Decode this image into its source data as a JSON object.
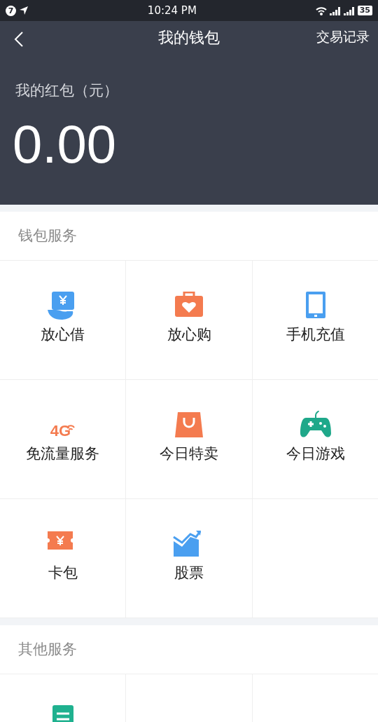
{
  "status_bar": {
    "notification_count": "7",
    "time": "10:24 PM",
    "battery": "35"
  },
  "header": {
    "title": "我的钱包",
    "action": "交易记录"
  },
  "balance": {
    "label": "我的红包（元）",
    "amount": "0.00"
  },
  "sections": [
    {
      "title": "钱包服务",
      "items": [
        {
          "label": "放心借",
          "kind": "loan"
        },
        {
          "label": "放心购",
          "kind": "gift"
        },
        {
          "label": "手机充值",
          "kind": "phone"
        },
        {
          "label": "免流量服务",
          "kind": "network",
          "icon_text": "4G"
        },
        {
          "label": "今日特卖",
          "kind": "bag"
        },
        {
          "label": "今日游戏",
          "kind": "gamepad"
        },
        {
          "label": "卡包",
          "kind": "ticket"
        },
        {
          "label": "股票",
          "kind": "chart"
        }
      ]
    },
    {
      "title": "其他服务",
      "items": [
        {
          "kind": "document"
        }
      ]
    }
  ]
}
